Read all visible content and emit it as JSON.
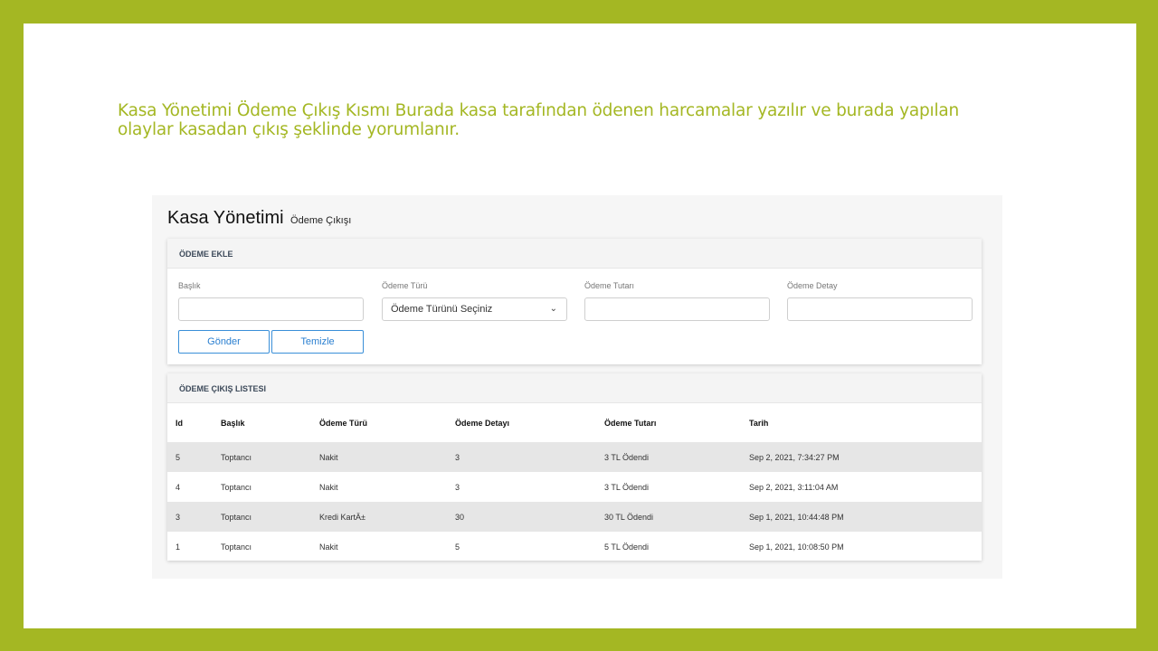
{
  "slide": {
    "text": "Kasa Yönetimi Ödeme Çıkış Kısmı Burada kasa tarafından ödenen harcamalar yazılır ve burada yapılan olaylar kasadan çıkış şeklinde yorumlanır."
  },
  "page": {
    "title": "Kasa Yönetimi",
    "subtitle": "Ödeme Çıkışı"
  },
  "add_form": {
    "header": "ÖDEME EKLE",
    "fields": [
      {
        "label": "Başlık",
        "value": ""
      },
      {
        "label": "Ödeme Türü",
        "value": "Ödeme Türünü Seçiniz"
      },
      {
        "label": "Ödeme Tutarı",
        "value": ""
      },
      {
        "label": "Ödeme Detay",
        "value": ""
      }
    ],
    "submit_label": "Gönder",
    "clear_label": "Temizle"
  },
  "list": {
    "header": "ÖDEME ÇIKIŞ LISTESI",
    "columns": [
      "Id",
      "Başlık",
      "Ödeme Türü",
      "Ödeme Detayı",
      "Ödeme Tutarı",
      "Tarih"
    ],
    "rows": [
      [
        "5",
        "Toptancı",
        "Nakit",
        "3",
        "3 TL Ödendi",
        "Sep 2, 2021, 7:34:27 PM"
      ],
      [
        "4",
        "Toptancı",
        "Nakit",
        "3",
        "3 TL Ödendi",
        "Sep 2, 2021, 3:11:04 AM"
      ],
      [
        "3",
        "Toptancı",
        "Kredi KartÄ±",
        "30",
        "30 TL Ödendi",
        "Sep 1, 2021, 10:44:48 PM"
      ],
      [
        "1",
        "Toptancı",
        "Nakit",
        "5",
        "5 TL Ödendi",
        "Sep 1, 2021, 10:08:50 PM"
      ]
    ]
  },
  "colors": {
    "frame": "#a4b723",
    "accent_text": "#a4b723",
    "button": "#2a7fd0"
  }
}
